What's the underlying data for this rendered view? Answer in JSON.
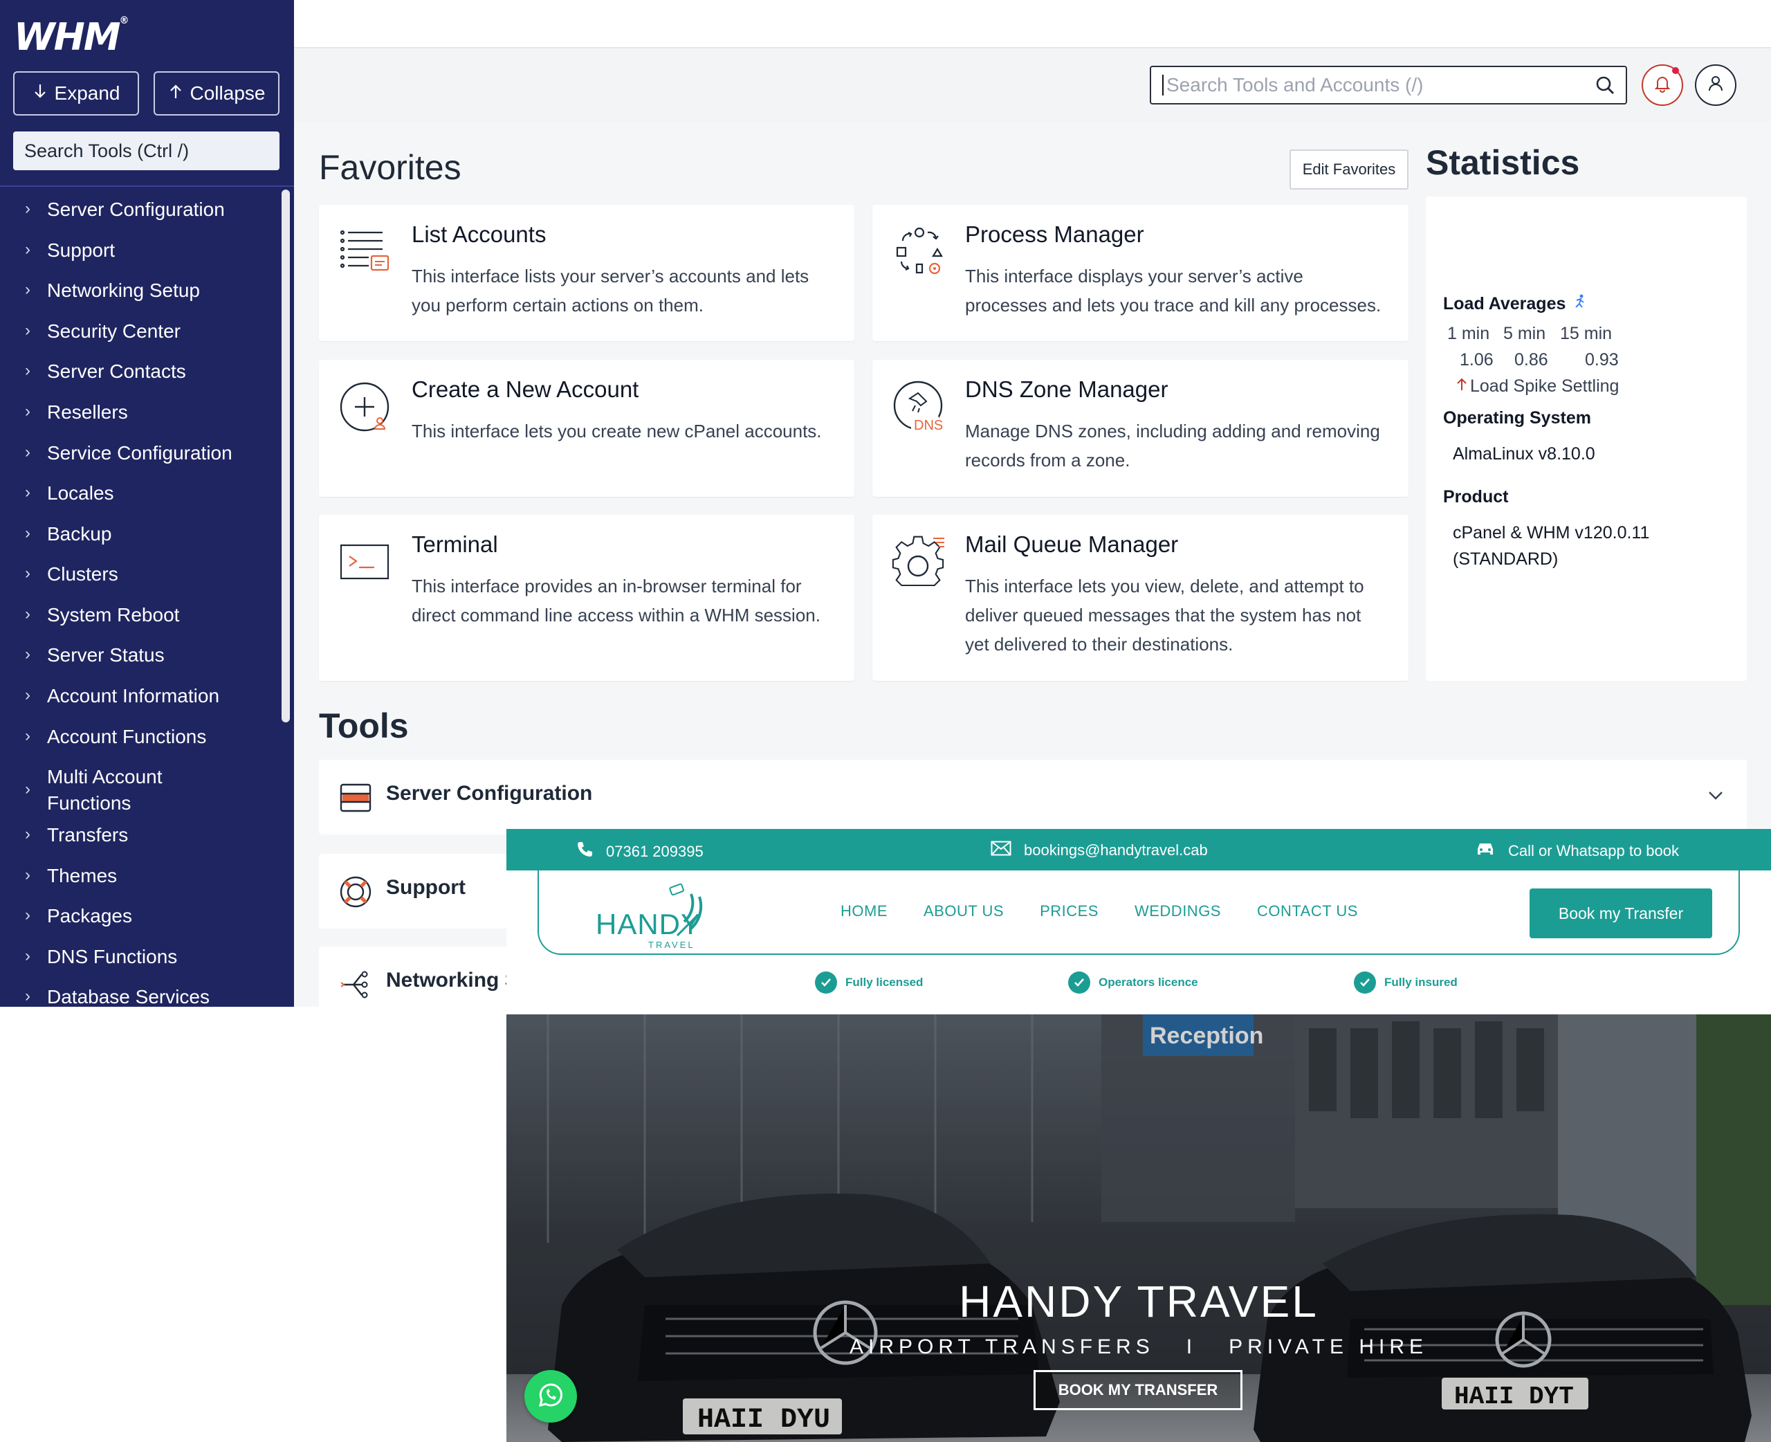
{
  "sidebar": {
    "logo": "WHM",
    "logo_mark": "®",
    "expand_label": "Expand",
    "collapse_label": "Collapse",
    "search_placeholder": "Search Tools (Ctrl /)",
    "items": [
      {
        "label": "Server Configuration"
      },
      {
        "label": "Support"
      },
      {
        "label": "Networking Setup"
      },
      {
        "label": "Security Center"
      },
      {
        "label": "Server Contacts"
      },
      {
        "label": "Resellers"
      },
      {
        "label": "Service Configuration"
      },
      {
        "label": "Locales"
      },
      {
        "label": "Backup"
      },
      {
        "label": "Clusters"
      },
      {
        "label": "System Reboot"
      },
      {
        "label": "Server Status"
      },
      {
        "label": "Account Information"
      },
      {
        "label": "Account Functions"
      },
      {
        "label": "Multi Account Functions"
      },
      {
        "label": "Transfers"
      },
      {
        "label": "Themes"
      },
      {
        "label": "Packages"
      },
      {
        "label": "DNS Functions"
      },
      {
        "label": "Database Services"
      }
    ]
  },
  "header": {
    "search_placeholder": "Search Tools and Accounts (/)",
    "icons": [
      "search-icon",
      "bell-icon",
      "user-icon"
    ],
    "notification_color": "#e11d48"
  },
  "favorites": {
    "title": "Favorites",
    "edit_label": "Edit Favorites",
    "cards": [
      {
        "title": "List Accounts",
        "desc": "This interface lists your server’s accounts and lets you perform certain actions on them."
      },
      {
        "title": "Process Manager",
        "desc": "This interface displays your server’s active processes and lets you trace and kill any processes."
      },
      {
        "title": "Create a New Account",
        "desc": "This interface lets you create new cPanel accounts."
      },
      {
        "title": "DNS Zone Manager",
        "desc": "Manage DNS zones, including adding and removing records from a zone.",
        "icon_text": "DNS"
      },
      {
        "title": "Terminal",
        "desc": "This interface provides an in-browser terminal for direct command line access within a WHM session."
      },
      {
        "title": "Mail Queue Manager",
        "desc": "This interface lets you view, delete, and attempt to deliver queued messages that the system has not yet delivered to their destinations."
      }
    ]
  },
  "statistics": {
    "title": "Statistics",
    "load_title": "Load Averages",
    "intervals": [
      "1 min",
      "5 min",
      "15 min"
    ],
    "loads": [
      "1.06",
      "0.86",
      "0.93"
    ],
    "load_status": "Load Spike Settling",
    "os_title": "Operating System",
    "os_value": "AlmaLinux v8.10.0",
    "product_title": "Product",
    "product_line1": "cPanel & WHM v120.0.11",
    "product_line2": "(STANDARD)"
  },
  "tools": {
    "title": "Tools",
    "rows": [
      {
        "label": "Server Configuration"
      },
      {
        "label": "Support"
      },
      {
        "label": "Networking Setup"
      }
    ]
  },
  "handy": {
    "phone": "07361 209395",
    "email": "bookings@handytravel.cab",
    "callout": "Call or Whatsapp to book",
    "logo_main": "HANDY",
    "logo_sub": "TRAVEL",
    "menu": [
      "HOME",
      "ABOUT US",
      "PRICES",
      "WEDDINGS",
      "CONTACT US"
    ],
    "book_label": "Book my Transfer",
    "badges": [
      "Fully licensed",
      "Operators licence",
      "Fully insured"
    ],
    "hero_title": "HANDY TRAVEL",
    "hero_sub": "AIRPORT TRANSFERS   I   PRIVATE HIRE",
    "hero_button": "BOOK MY TRANSFER",
    "plate_left": "HAII DYU",
    "plate_right": "HAII DYT",
    "sign_text": "Reception",
    "brand_color": "#1c9d94"
  },
  "colors": {
    "sidebar_bg": "#1f2560",
    "main_bg": "#f5f6f8",
    "accent_orange": "#e8643a"
  }
}
